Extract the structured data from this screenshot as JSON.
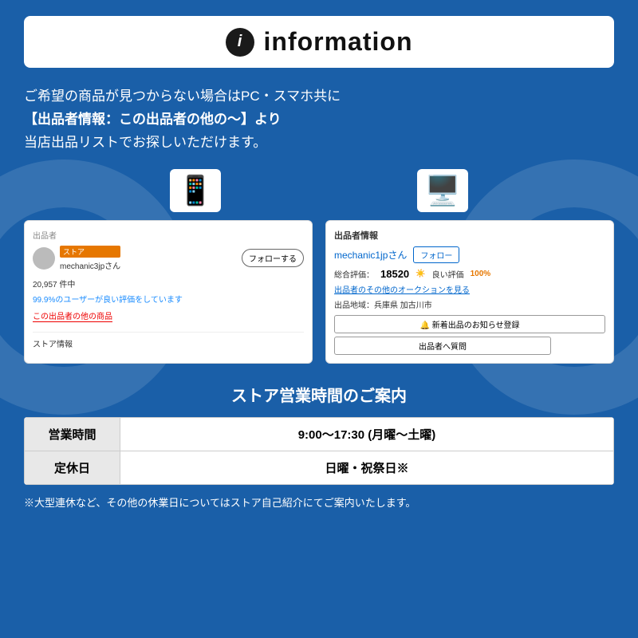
{
  "header": {
    "title": "information",
    "icon_label": "i"
  },
  "description": {
    "line1": "ご希望の商品が見つからない場合はPC・スマホ共に",
    "line2": "【出品者情報：この出品者の他の〜】より",
    "line3": "当店出品リストでお探しいただけます。"
  },
  "mobile_screenshot": {
    "section_label": "出品者",
    "store_badge": "ストア",
    "seller_name": "mechanic3jpさん",
    "follow_btn": "フォローする",
    "stats": "20,957 件中",
    "good_rate": "99.9%のユーザーが良い評価をしています",
    "other_items": "この出品者の他の商品",
    "store_info": "ストア情報"
  },
  "desktop_screenshot": {
    "section_label": "出品者情報",
    "seller_name": "mechanic1jpさん",
    "follow_btn": "フォロー",
    "rating_label": "総合評価：",
    "rating_num": "18520",
    "good_label": "良い評価",
    "good_pct": "100%",
    "auction_link": "出品者のその他のオークションを見る",
    "location": "出品地域：兵庫県 加古川市",
    "notify_btn": "🔔 新着出品のお知らせ登録",
    "question_btn": "出品者へ質問"
  },
  "store_hours": {
    "title": "ストア営業時間のご案内",
    "rows": [
      {
        "label": "営業時間",
        "value": "9:00〜17:30 (月曜〜土曜)"
      },
      {
        "label": "定休日",
        "value": "日曜・祝祭日※"
      }
    ],
    "footnote": "※大型連休など、その他の休業日についてはストア自己紹介にてご案内いたします。"
  }
}
